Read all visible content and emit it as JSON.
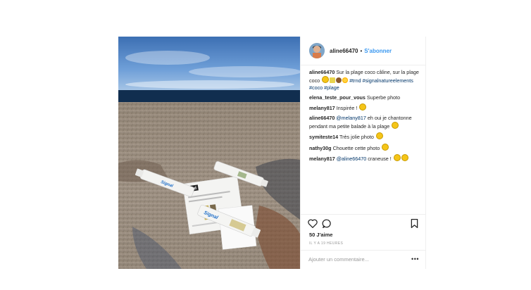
{
  "header": {
    "username": "aline66470",
    "separator": "•",
    "follow_label": "S'abonner"
  },
  "caption": {
    "user": "aline66470",
    "text": "Sur la plage coco câline, sur la plage coco",
    "hashtags": "#trnd #signalnatureelements #coco #plage"
  },
  "comments": [
    {
      "user": "elena_teste_pour_vous",
      "mention": "",
      "text": "Superbe photo"
    },
    {
      "user": "melany817",
      "mention": "",
      "text": "Inspirée !"
    },
    {
      "user": "aline66470",
      "mention": "@melany817",
      "text": "eh oui je chantonne pendant ma petite balade à la plage"
    },
    {
      "user": "symiteste14",
      "mention": "",
      "text": "Très jolie photo"
    },
    {
      "user": "nathy30g",
      "mention": "",
      "text": "Chouette cette photo"
    },
    {
      "user": "melany817",
      "mention": "@aline66470",
      "text": "craneuse !"
    }
  ],
  "icons": {
    "like": "heart-icon",
    "comment": "comment-icon",
    "save": "bookmark-icon",
    "more": "more-options-icon"
  },
  "likes": "50 J'aime",
  "timestamp": "IL Y A 19 HEURES",
  "add_comment": {
    "placeholder": "Ajouter un commentaire..."
  },
  "more_label": "•••",
  "photo_print": {
    "box_brand": "trnd",
    "tube_brand": "Signal"
  },
  "colors": {
    "link": "#3897f0",
    "hashtag": "#003569",
    "text": "#262626",
    "muted": "#999999",
    "border": "#efefef"
  }
}
